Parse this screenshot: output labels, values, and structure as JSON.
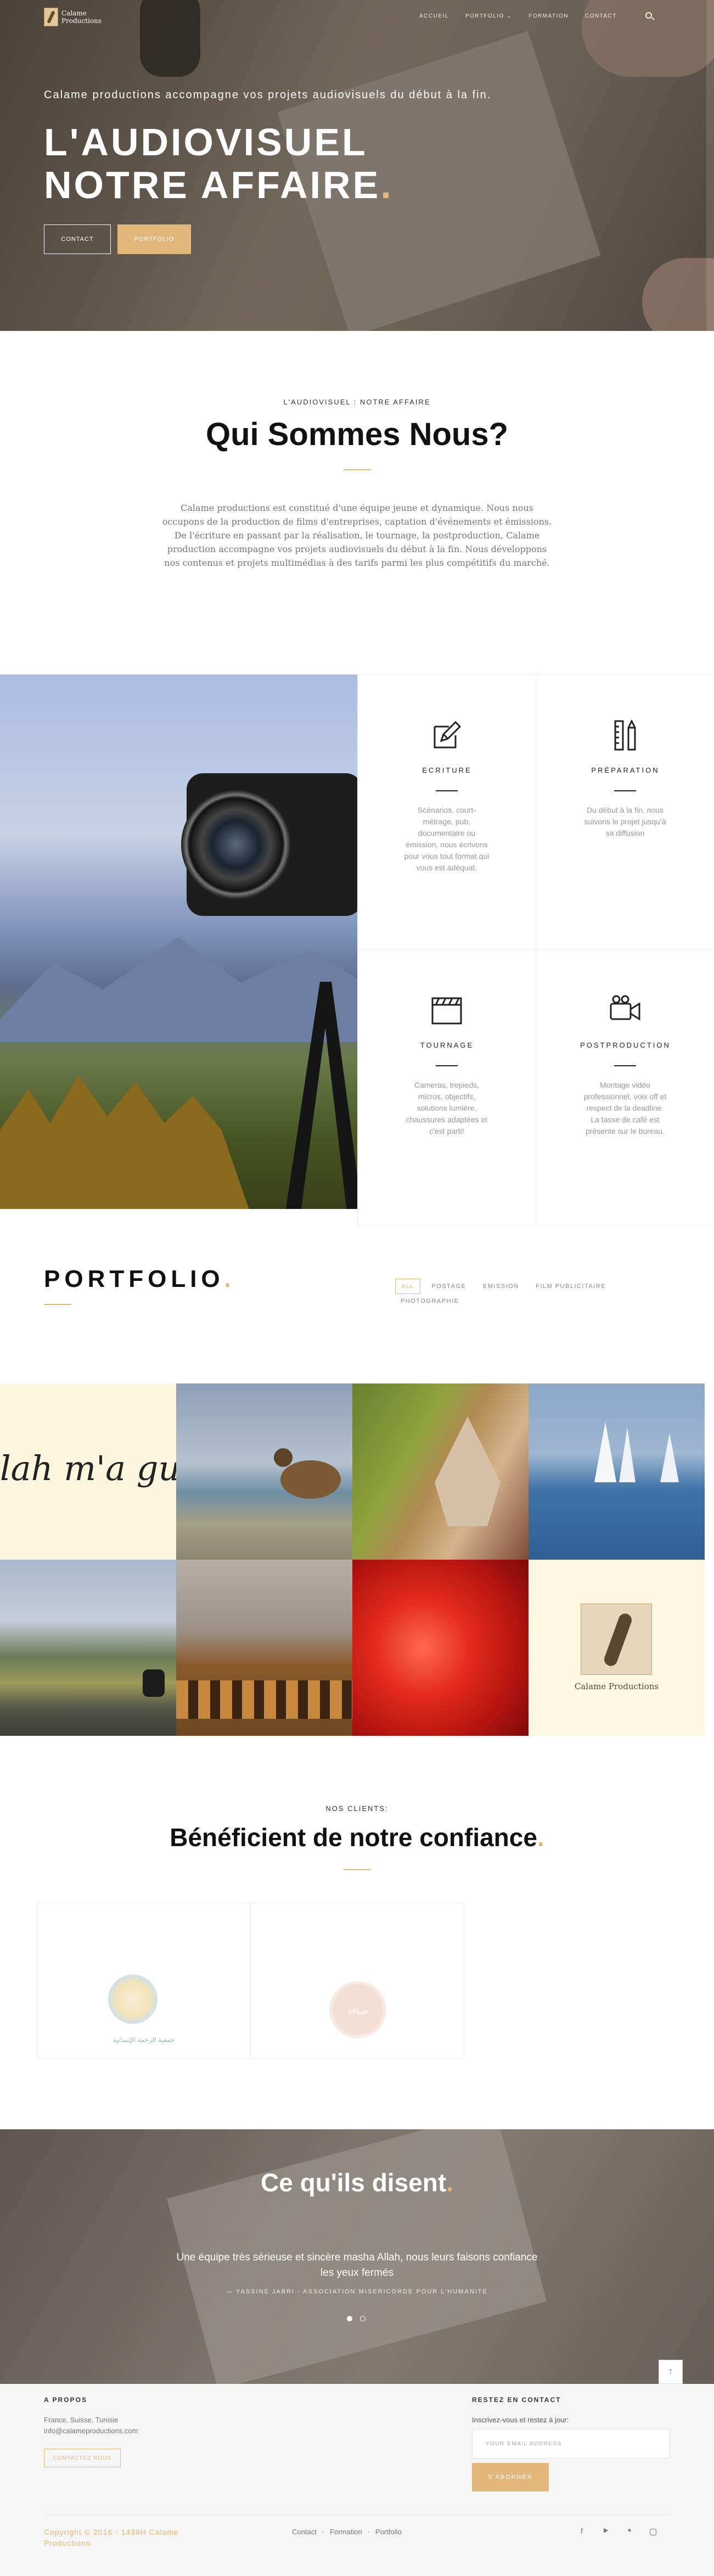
{
  "brand": {
    "name_line1": "Calame",
    "name_line2": "Productions"
  },
  "nav": {
    "items": [
      "ACCUEIL",
      "PORTFOLIO ⌄",
      "FORMATION",
      "CONTACT"
    ]
  },
  "hero": {
    "subtitle": "Calame productions accompagne vos projets audiovisuels du début à la fin.",
    "title_line1": "L'AUDIOVISUEL",
    "title_line2": "NOTRE AFFAIRE",
    "title_dot": ".",
    "btn_contact": "CONTACT",
    "btn_portfolio": "PORTFOLIO"
  },
  "about": {
    "kicker": "L'AUDIOVISUEL : NOTRE AFFAIRE",
    "title": "Qui Sommes Nous?",
    "text": "Calame productions est constitué d'une équipe jeune et dynamique. Nous nous occupons de la production de films d'entreprises, captation d'événements et émissions. De l'écriture en passant par la réalisation, le tournage, la postproduction, Calame production accompagne vos projets audiovisuels du début à la fin. Nous développons nos contenus et projets multimédias à des tarifs parmi les plus compétitifs du marché."
  },
  "services": [
    {
      "icon": "pencil-paper-icon",
      "title": "ECRITURE",
      "text": "Scénarios, court-métrage, pub, documentaire ou émission, nous écrivons pour vous tout format qui vous est adéquat."
    },
    {
      "icon": "pencil-ruler-icon",
      "title": "PRÉPARATION",
      "text": "Du début à la fin, nous suivons le projet jusqu'à sa diffusion"
    },
    {
      "icon": "clapperboard-icon",
      "title": "TOURNAGE",
      "text": "Cameras, trepieds, micros, objectifs, solutions lumière, chaussures adaptées et c'est parti!"
    },
    {
      "icon": "video-camera-icon",
      "title": "POSTPRODUCTION",
      "text": "Montage vidéo professionnel, voix off et respect de la deadline. La tasse de café est présente sur le bureau."
    }
  ],
  "portfolio": {
    "title": "PORTFOLIO",
    "filters": [
      "ALL",
      "POSTAGE",
      "EMISSION",
      "FILM PUBLICITAIRE",
      "PHOTOGRAPHIE"
    ],
    "tile_calligraphy": "llah m'a gu",
    "tile_logo_caption": "Calame Productions"
  },
  "clients": {
    "kicker": "NOS CLIENTS:",
    "title": "Bénéficient de notre confiance",
    "logo1_caption": "جمعية الرحمة الإنسانية",
    "logo2_caption": "ضيافة"
  },
  "testimonial": {
    "title": "Ce qu'ils disent",
    "quote": "Une équipe très sérieuse et sincère masha Allah, nous leurs faisons confiance les yeux fermés",
    "author": "— YASSINE JABRI - ASSOCIATION MISERICORDE POUR L'HUMANITE"
  },
  "footer": {
    "about_heading": "A PROPOS",
    "address": "France, Suisse, Tunisie",
    "email": "info@calameproductions.com",
    "contact_btn": "CONTACTEZ NOUS",
    "newsletter_heading": "RESTEZ EN CONTACT",
    "newsletter_text": "Inscrivez-vous et restez à jour:",
    "email_placeholder": "YOUR EMAIL ADDRESS",
    "subscribe": "S'ABONNER",
    "copyright": "Copyright © 2016 - 1438H Calame Productions.",
    "links": [
      "Contact",
      "Formation",
      "Portfolio"
    ]
  },
  "colors": {
    "accent": "#e3b77a"
  }
}
